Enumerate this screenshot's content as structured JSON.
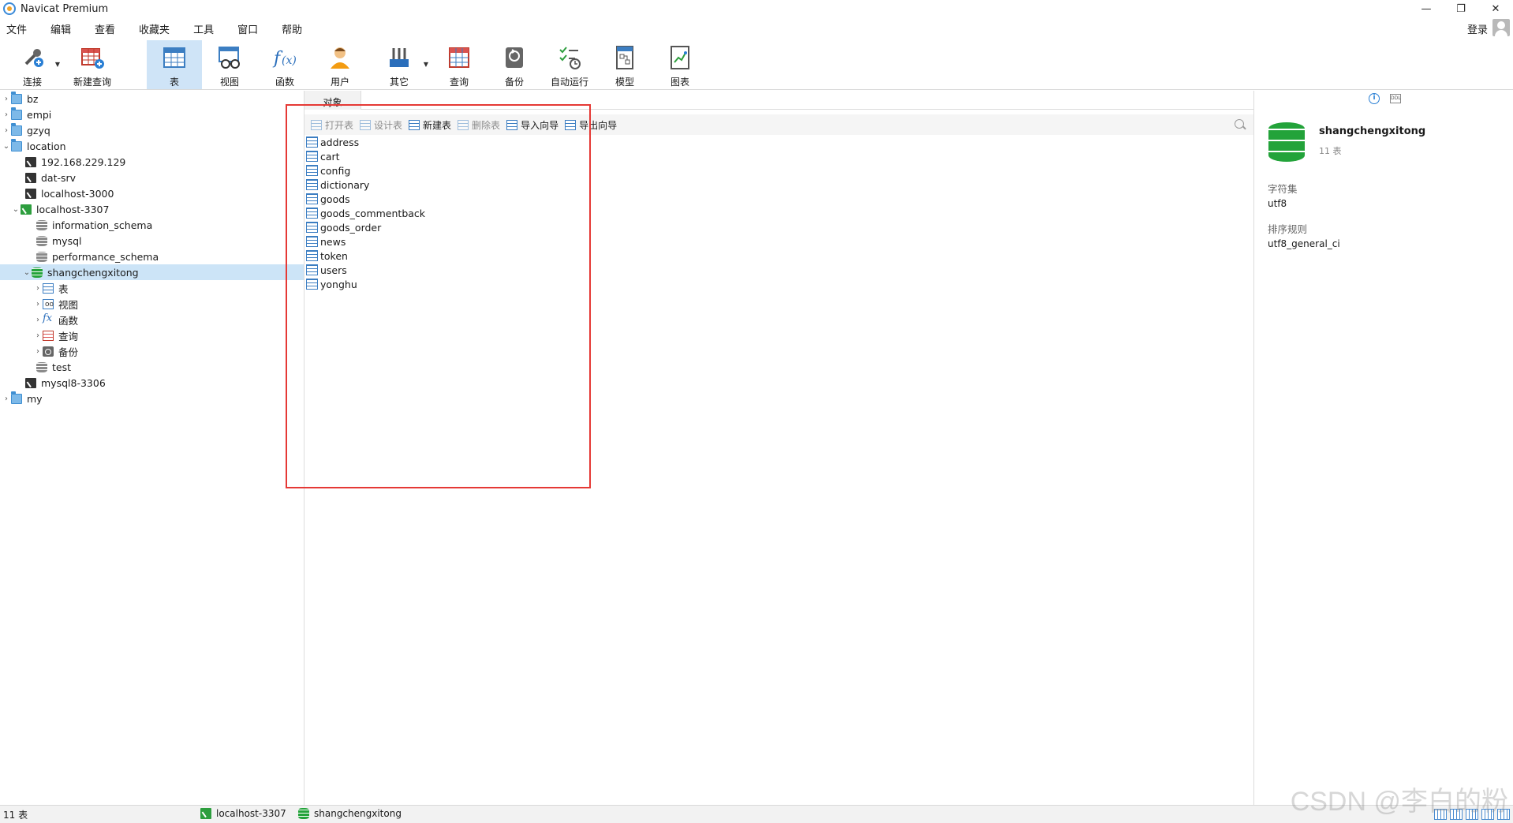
{
  "window": {
    "title": "Navicat Premium",
    "minimize": "—",
    "restore": "❐",
    "close": "✕"
  },
  "menu": {
    "items": [
      "文件",
      "编辑",
      "查看",
      "收藏夹",
      "工具",
      "窗口",
      "帮助"
    ],
    "login": "登录"
  },
  "toolbar": {
    "items": [
      {
        "label": "连接",
        "icon": "connection-icon"
      },
      {
        "label": "新建查询",
        "icon": "new-query-icon"
      },
      {
        "label": "表",
        "icon": "table-icon",
        "active": true
      },
      {
        "label": "视图",
        "icon": "view-icon"
      },
      {
        "label": "函数",
        "icon": "function-icon"
      },
      {
        "label": "用户",
        "icon": "user-icon"
      },
      {
        "label": "其它",
        "icon": "others-icon"
      },
      {
        "label": "查询",
        "icon": "query-icon"
      },
      {
        "label": "备份",
        "icon": "backup-icon"
      },
      {
        "label": "自动运行",
        "icon": "automation-icon"
      },
      {
        "label": "模型",
        "icon": "model-icon"
      },
      {
        "label": "图表",
        "icon": "chart-icon"
      }
    ]
  },
  "tree": [
    {
      "label": "bz",
      "icon": "folder",
      "arrow": "›"
    },
    {
      "label": "empi",
      "icon": "folder",
      "arrow": "›"
    },
    {
      "label": "gzyq",
      "icon": "folder",
      "arrow": "›"
    },
    {
      "label": "location",
      "icon": "folder",
      "arrow": "⌄"
    },
    {
      "label": "192.168.229.129",
      "icon": "conn"
    },
    {
      "label": "dat-srv",
      "icon": "conn"
    },
    {
      "label": "localhost-3000",
      "icon": "conn"
    },
    {
      "label": "localhost-3307",
      "icon": "conn-on",
      "arrow": "⌄"
    },
    {
      "label": "information_schema",
      "icon": "db"
    },
    {
      "label": "mysql",
      "icon": "db"
    },
    {
      "label": "performance_schema",
      "icon": "db"
    },
    {
      "label": "shangchengxitong",
      "icon": "db-on",
      "arrow": "⌄",
      "selected": true
    },
    {
      "label": "表",
      "icon": "mini-table",
      "arrow": "›"
    },
    {
      "label": "视图",
      "icon": "mini-view",
      "arrow": "›"
    },
    {
      "label": "函数",
      "icon": "mini-fx",
      "arrow": "›"
    },
    {
      "label": "查询",
      "icon": "mini-query",
      "arrow": "›"
    },
    {
      "label": "备份",
      "icon": "mini-backup",
      "arrow": "›"
    },
    {
      "label": "test",
      "icon": "db"
    },
    {
      "label": "mysql8-3306",
      "icon": "conn"
    },
    {
      "label": "my",
      "icon": "folder",
      "arrow": "›"
    }
  ],
  "objects_tab": {
    "label": "对象"
  },
  "object_toolbar": {
    "open": "打开表",
    "design": "设计表",
    "new": "新建表",
    "delete": "删除表",
    "import": "导入向导",
    "export": "导出向导"
  },
  "tables": [
    "address",
    "cart",
    "config",
    "dictionary",
    "goods",
    "goods_commentback",
    "goods_order",
    "news",
    "token",
    "users",
    "yonghu"
  ],
  "info": {
    "db_name": "shangchengxitong",
    "table_count": "11 表",
    "charset_label": "字符集",
    "charset": "utf8",
    "collation_label": "排序规则",
    "collation": "utf8_general_ci"
  },
  "status": {
    "count": "11 表",
    "connection": "localhost-3307",
    "database": "shangchengxitong"
  },
  "watermark": "CSDN @李白的粉",
  "colors": {
    "highlight_box": "#e53935",
    "selection": "#cce4f7",
    "active_tool": "#cfe4f7"
  }
}
